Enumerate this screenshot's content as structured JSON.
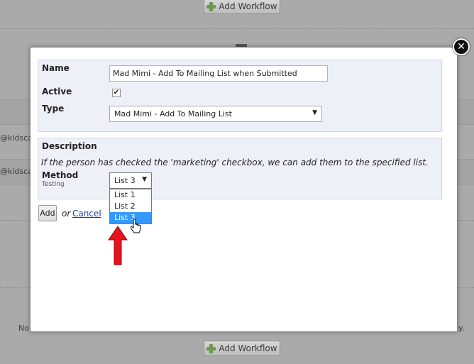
{
  "background": {
    "add_workflow_label": "Add Workflow",
    "email_fragment_1": "@kidscap",
    "email_fragment_2": "@kidscap",
    "left_fragment": "No",
    "right_fragment": "y."
  },
  "modal": {
    "name_label": "Name",
    "name_value": "Mad Mimi - Add To Mailing List when Submitted",
    "active_label": "Active",
    "active_checked_mark": "✔",
    "type_label": "Type",
    "type_value": "Mad Mimi - Add To Mailing List",
    "description_label": "Description",
    "description_text": "If the person has checked the 'marketing' checkbox, we can add them to the specified list.",
    "method_label": "Method",
    "method_sub": "Testing",
    "method_value": "List 3",
    "method_options": [
      "List 1",
      "List 2",
      "List 3"
    ],
    "add_label": "Add",
    "or_label": "or",
    "cancel_label": "Cancel",
    "close_glyph": "✕"
  },
  "icons": {
    "dropdown_arrow": "▼"
  },
  "colors": {
    "selection": "#3399ff",
    "annotation_arrow": "#e8121b",
    "link": "#1f3fa8"
  }
}
